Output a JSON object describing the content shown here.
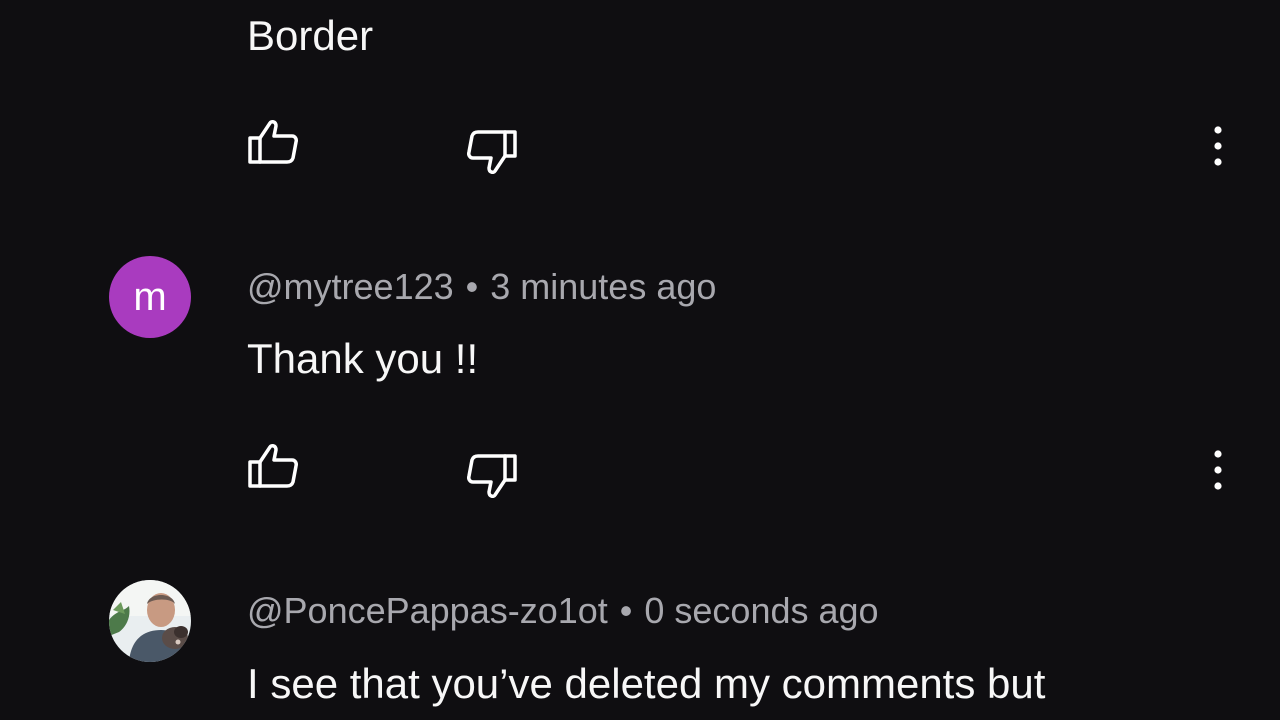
{
  "comments": [
    {
      "text_partial": "Border",
      "like_icon": "thumbs-up-icon",
      "dislike_icon": "thumbs-down-icon",
      "menu_icon": "vertical-ellipsis-icon"
    },
    {
      "avatar_letter": "m",
      "avatar_color": "#a93bbf",
      "author": "@mytree123",
      "separator": "•",
      "time": "3 minutes ago",
      "text": "Thank you !!",
      "like_icon": "thumbs-up-icon",
      "dislike_icon": "thumbs-down-icon",
      "menu_icon": "vertical-ellipsis-icon"
    },
    {
      "avatar": "user-photo",
      "author": "@PoncePappas-zo1ot",
      "separator": "•",
      "time": "0 seconds ago",
      "text": "I see that you’ve deleted my comments but"
    }
  ],
  "colors": {
    "background": "#0f0e11",
    "primary_text": "#f7f7f7",
    "secondary_text": "#a8a8ae"
  }
}
